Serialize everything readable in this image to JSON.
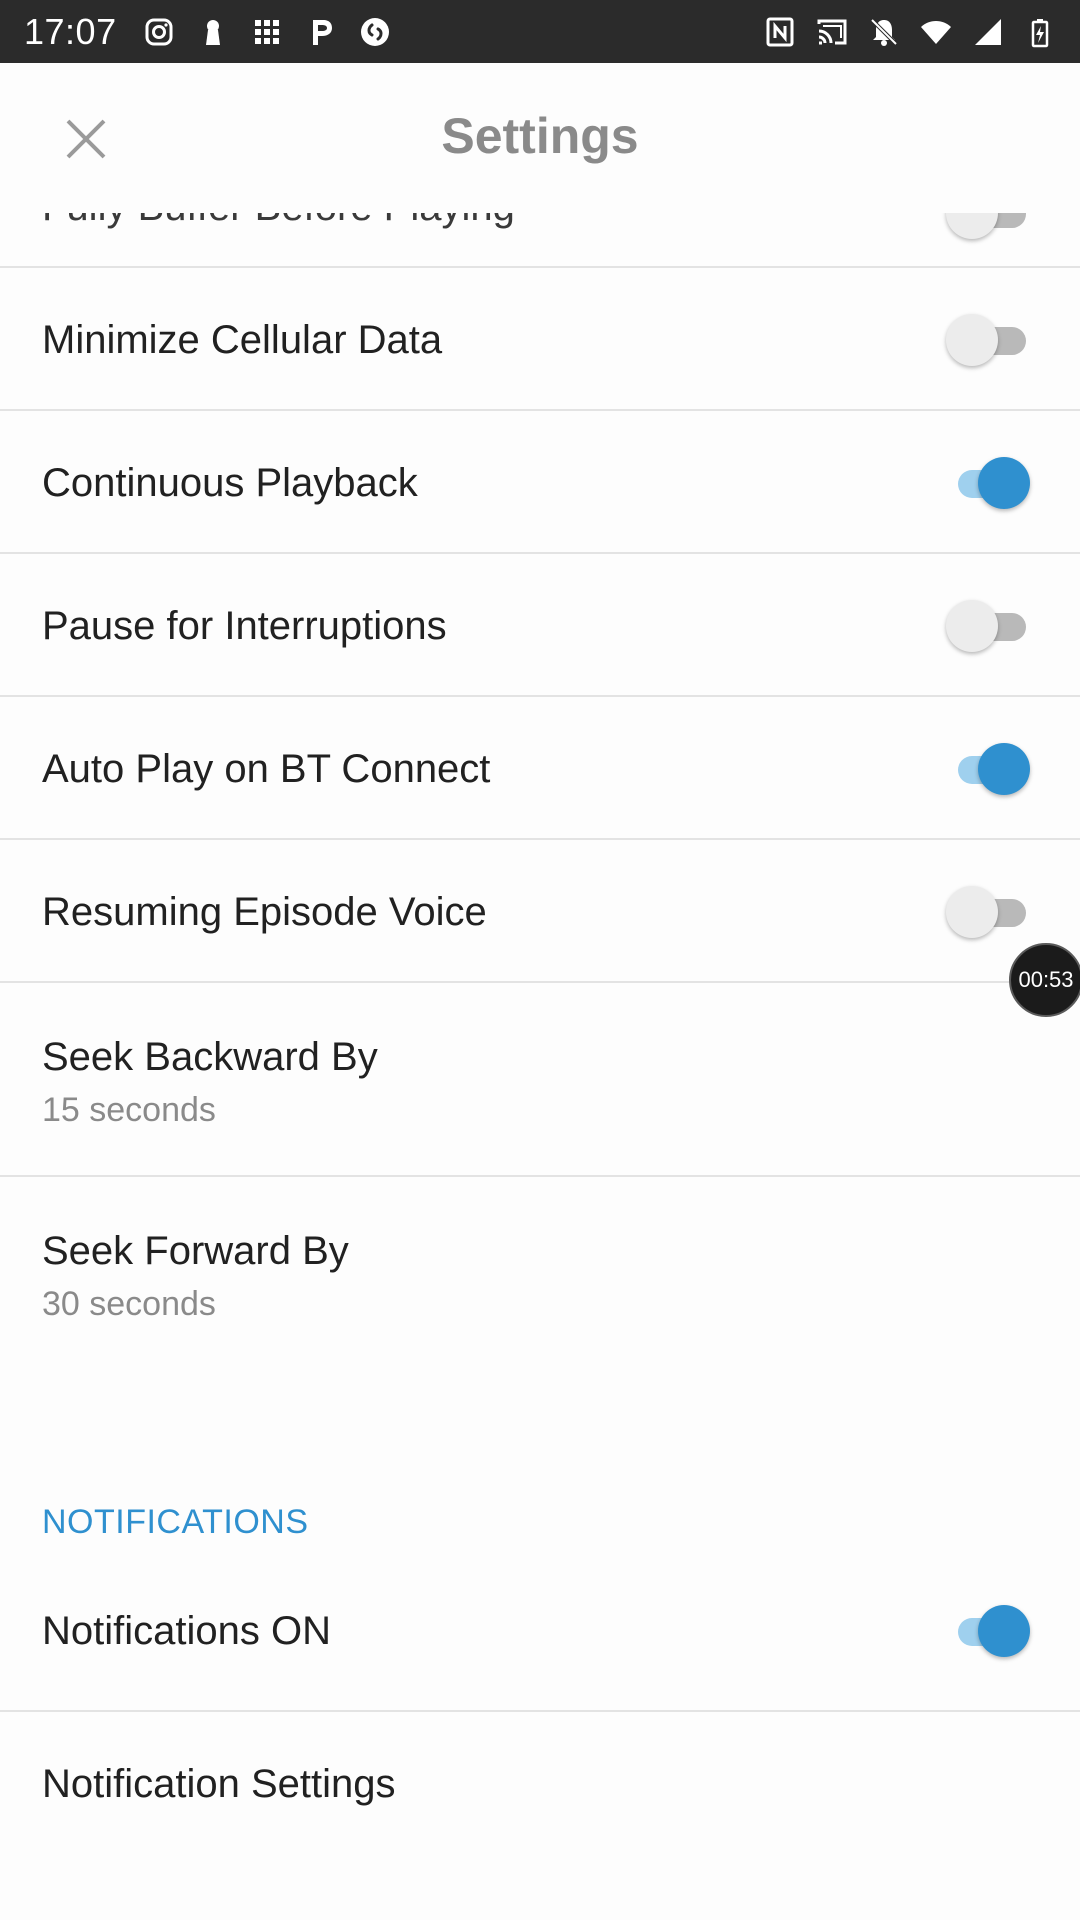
{
  "status_bar": {
    "time": "17:07",
    "left_icons": [
      "instagram-icon",
      "keyhole-icon",
      "apps-grid-icon",
      "parking-icon",
      "shazam-icon"
    ],
    "right_icons": [
      "nfc-icon",
      "cast-icon",
      "bell-off-icon",
      "wifi-icon",
      "cell-signal-icon",
      "battery-charging-icon"
    ]
  },
  "app_bar": {
    "title": "Settings",
    "close_icon": "close-icon"
  },
  "settings": {
    "partial_item": {
      "label": "Fully Buffer Before Playing",
      "on": false
    },
    "toggles": [
      {
        "label": "Minimize Cellular Data",
        "on": false
      },
      {
        "label": "Continuous Playback",
        "on": true
      },
      {
        "label": "Pause for Interruptions",
        "on": false
      },
      {
        "label": "Auto Play on BT Connect",
        "on": true
      },
      {
        "label": "Resuming Episode Voice",
        "on": false
      }
    ],
    "seek_backward": {
      "label": "Seek Backward By",
      "value": "15 seconds"
    },
    "seek_forward": {
      "label": "Seek Forward By",
      "value": "30 seconds"
    }
  },
  "notifications": {
    "section_title": "NOTIFICATIONS",
    "toggle": {
      "label": "Notifications ON",
      "on": true
    },
    "settings_label": "Notification Settings"
  },
  "timer_bubble": {
    "text": "00:53"
  },
  "colors": {
    "accent": "#2f90cf",
    "accent_track": "#9fd0ee",
    "status_bar": "#2b2b2b",
    "divider": "#e3e3e3"
  }
}
